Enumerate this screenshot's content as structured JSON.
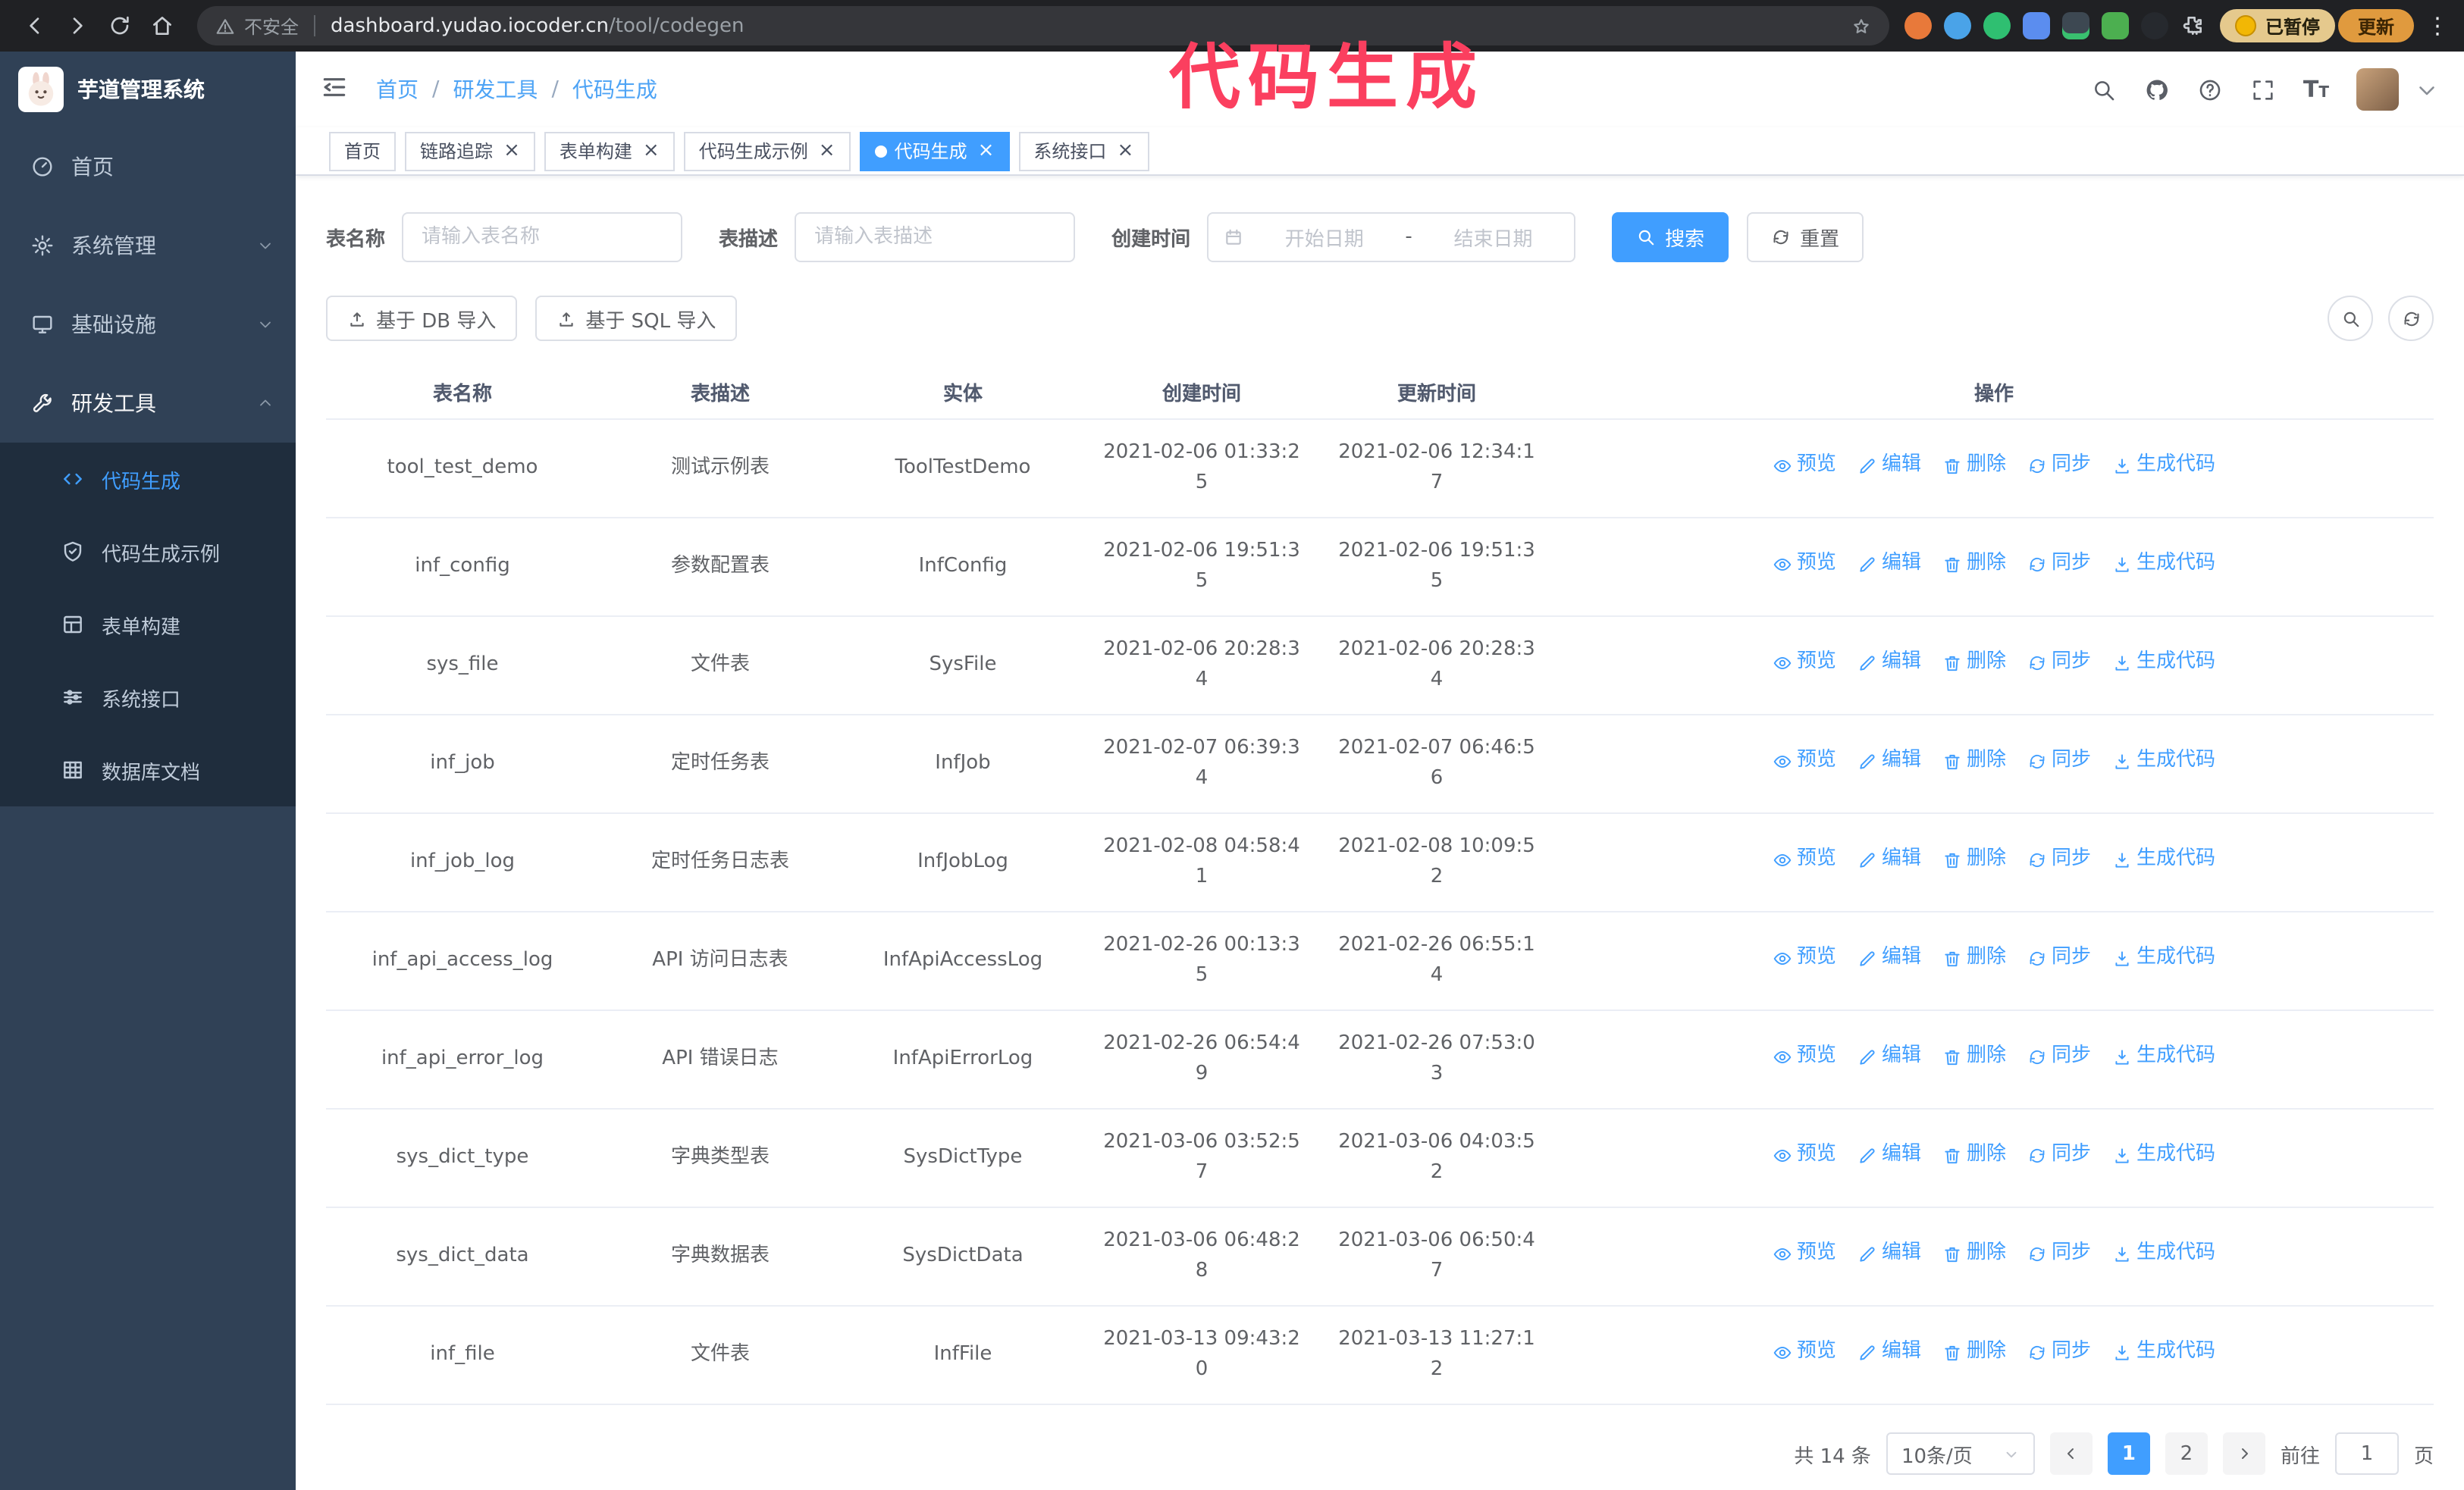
{
  "annotation": {
    "text": "代码生成"
  },
  "browser": {
    "security_label": "不安全",
    "url_domain": "dashboard.yudao.iocoder.cn",
    "url_path": "/tool/codegen",
    "profile_badge": "已暂停",
    "update_button": "更新"
  },
  "sidebar": {
    "logo_title": "芋道管理系统",
    "items": [
      {
        "label": "首页"
      },
      {
        "label": "系统管理"
      },
      {
        "label": "基础设施"
      },
      {
        "label": "研发工具"
      }
    ],
    "submenu": [
      {
        "label": "代码生成"
      },
      {
        "label": "代码生成示例"
      },
      {
        "label": "表单构建"
      },
      {
        "label": "系统接口"
      },
      {
        "label": "数据库文档"
      }
    ]
  },
  "navbar": {
    "breadcrumb": [
      "首页",
      "研发工具",
      "代码生成"
    ]
  },
  "tabs": [
    {
      "label": "首页"
    },
    {
      "label": "链路追踪"
    },
    {
      "label": "表单构建"
    },
    {
      "label": "代码生成示例"
    },
    {
      "label": "代码生成"
    },
    {
      "label": "系统接口"
    }
  ],
  "filters": {
    "table_name_label": "表名称",
    "table_name_placeholder": "请输入表名称",
    "table_desc_label": "表描述",
    "table_desc_placeholder": "请输入表描述",
    "create_time_label": "创建时间",
    "date_start_placeholder": "开始日期",
    "date_separator": "-",
    "date_end_placeholder": "结束日期",
    "search_button": "搜索",
    "reset_button": "重置"
  },
  "toolbar": {
    "import_db": "基于 DB 导入",
    "import_sql": "基于 SQL 导入"
  },
  "table": {
    "columns": [
      "表名称",
      "表描述",
      "实体",
      "创建时间",
      "更新时间",
      "操作"
    ],
    "actions": [
      "预览",
      "编辑",
      "删除",
      "同步",
      "生成代码"
    ],
    "rows": [
      {
        "name": "tool_test_demo",
        "desc": "测试示例表",
        "entity": "ToolTestDemo",
        "created": "2021-02-06 01:33:25",
        "updated": "2021-02-06 12:34:17"
      },
      {
        "name": "inf_config",
        "desc": "参数配置表",
        "entity": "InfConfig",
        "created": "2021-02-06 19:51:35",
        "updated": "2021-02-06 19:51:35"
      },
      {
        "name": "sys_file",
        "desc": "文件表",
        "entity": "SysFile",
        "created": "2021-02-06 20:28:34",
        "updated": "2021-02-06 20:28:34"
      },
      {
        "name": "inf_job",
        "desc": "定时任务表",
        "entity": "InfJob",
        "created": "2021-02-07 06:39:34",
        "updated": "2021-02-07 06:46:56"
      },
      {
        "name": "inf_job_log",
        "desc": "定时任务日志表",
        "entity": "InfJobLog",
        "created": "2021-02-08 04:58:41",
        "updated": "2021-02-08 10:09:52"
      },
      {
        "name": "inf_api_access_log",
        "desc": "API 访问日志表",
        "entity": "InfApiAccessLog",
        "created": "2021-02-26 00:13:35",
        "updated": "2021-02-26 06:55:14"
      },
      {
        "name": "inf_api_error_log",
        "desc": "API 错误日志",
        "entity": "InfApiErrorLog",
        "created": "2021-02-26 06:54:49",
        "updated": "2021-02-26 07:53:03"
      },
      {
        "name": "sys_dict_type",
        "desc": "字典类型表",
        "entity": "SysDictType",
        "created": "2021-03-06 03:52:57",
        "updated": "2021-03-06 04:03:52"
      },
      {
        "name": "sys_dict_data",
        "desc": "字典数据表",
        "entity": "SysDictData",
        "created": "2021-03-06 06:48:28",
        "updated": "2021-03-06 06:50:47"
      },
      {
        "name": "inf_file",
        "desc": "文件表",
        "entity": "InfFile",
        "created": "2021-03-13 09:43:20",
        "updated": "2021-03-13 11:27:12"
      }
    ]
  },
  "pagination": {
    "total": "共 14 条",
    "page_size": "10条/页",
    "pages": [
      "1",
      "2"
    ],
    "goto_label": "前往",
    "goto_value": "1",
    "goto_suffix": "页"
  }
}
